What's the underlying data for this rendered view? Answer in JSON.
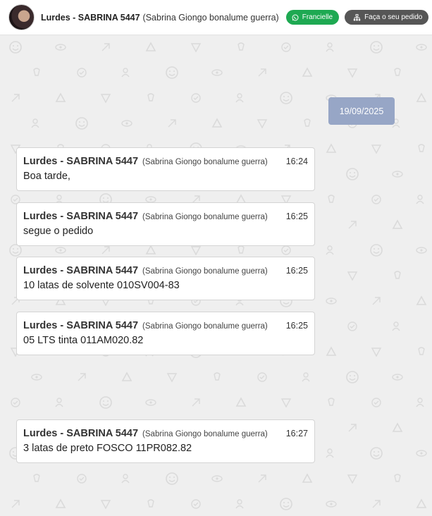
{
  "header": {
    "contact_name": "Lurdes - SABRINA 5447",
    "contact_sub": "(Sabrina Giongo bonalume guerra)",
    "whatsapp_label": "Francielle",
    "order_label": "Faça o seu pedido",
    "whatsapp_color": "#1ea952",
    "order_color": "#565656"
  },
  "chat": {
    "date": "19/09/2025",
    "messages": [
      {
        "name": "Lurdes - SABRINA 5447",
        "sub": "(Sabrina Giongo bonalume guerra)",
        "time": "16:24",
        "text": "Boa tarde,"
      },
      {
        "name": "Lurdes - SABRINA 5447",
        "sub": "(Sabrina Giongo bonalume guerra)",
        "time": "16:25",
        "text": "segue o pedido"
      },
      {
        "name": "Lurdes - SABRINA 5447",
        "sub": "(Sabrina Giongo bonalume guerra)",
        "time": "16:25",
        "text": "10 latas de solvente 010SV004-83"
      },
      {
        "name": "Lurdes - SABRINA 5447",
        "sub": "(Sabrina Giongo bonalume guerra)",
        "time": "16:25",
        "text": "05 LTS tinta 011AM020.82"
      },
      {
        "name": "Lurdes - SABRINA 5447",
        "sub": "(Sabrina Giongo bonalume guerra)",
        "time": "16:27",
        "text": "3 latas de preto FOSCO 11PR082.82"
      }
    ]
  }
}
